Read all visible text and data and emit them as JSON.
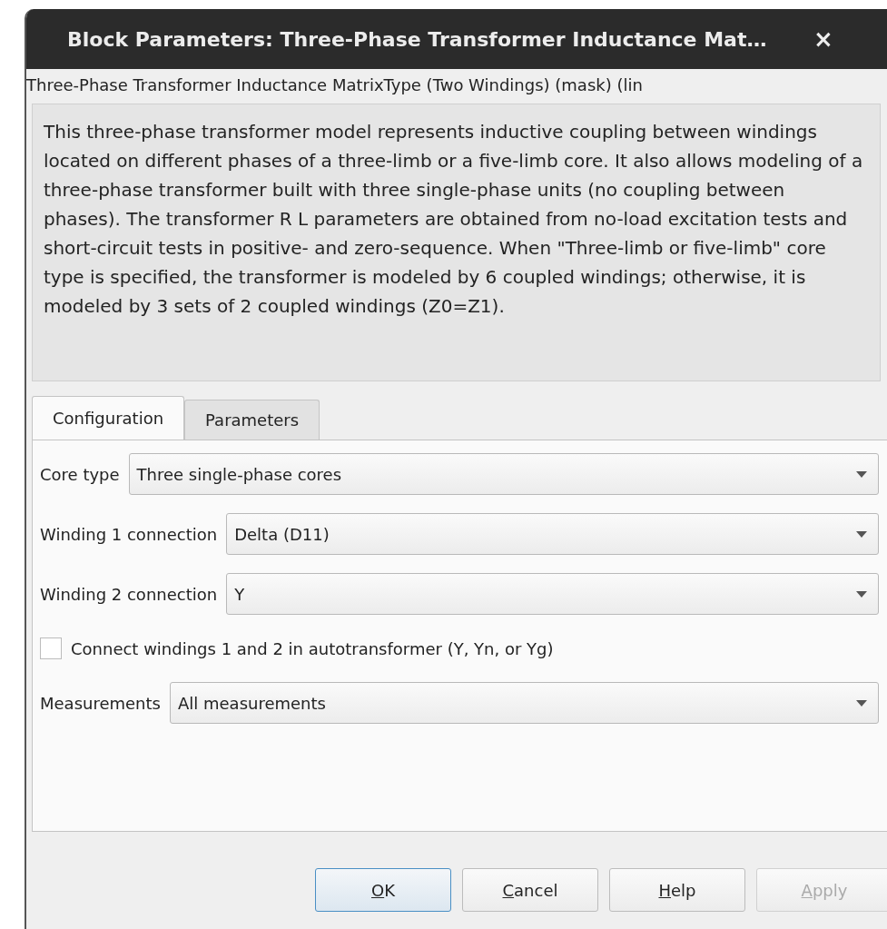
{
  "window": {
    "title": "Block Parameters: Three-Phase Transformer Inductance Mat…",
    "close": "×"
  },
  "block_name": "Three-Phase Transformer Inductance MatrixType (Two Windings) (mask) (lin",
  "description": "This three-phase transformer model represents inductive coupling between windings located on different phases of a three-limb or a five-limb core.  It also allows modeling of a three-phase transformer built with three single-phase units (no coupling between phases). The transformer R L parameters are obtained from no-load excitation tests and short-circuit tests in positive- and zero-sequence. When \"Three-limb or five-limb\" core type is specified, the transformer is modeled by 6 coupled windings; otherwise, it is modeled by 3 sets of 2 coupled windings (Z0=Z1).",
  "tabs": [
    {
      "label": "Configuration",
      "selected": true
    },
    {
      "label": "Parameters",
      "selected": false
    }
  ],
  "fields": [
    {
      "kind": "dropdown",
      "label": "Core type",
      "value": "Three single-phase cores"
    },
    {
      "kind": "dropdown",
      "label": "Winding 1 connection",
      "value": "Delta (D11)"
    },
    {
      "kind": "dropdown",
      "label": "Winding 2 connection",
      "value": "Y"
    },
    {
      "kind": "checkbox",
      "label": "Connect windings 1 and 2 in autotransformer  (Y, Yn, or Yg)",
      "checked": false
    },
    {
      "kind": "dropdown",
      "label": "Measurements",
      "value": "All measurements"
    }
  ],
  "buttons": [
    {
      "label": "OK",
      "underline_first": true,
      "disabled": false,
      "default": true
    },
    {
      "label": "Cancel",
      "underline_first": true,
      "disabled": false,
      "default": false
    },
    {
      "label": "Help",
      "underline_first": true,
      "disabled": false,
      "default": false
    },
    {
      "label": "Apply",
      "underline_first": true,
      "disabled": true,
      "default": false
    }
  ]
}
